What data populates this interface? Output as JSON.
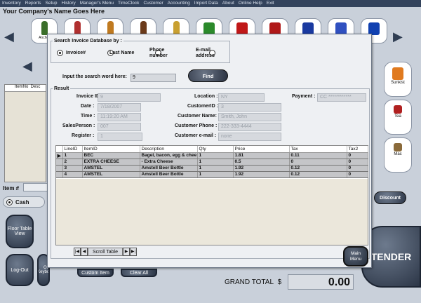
{
  "menubar": [
    "Inventory",
    "Reports",
    "Setup",
    "History",
    "Manager's Menu",
    "TimeClock",
    "Customer",
    "Accounting",
    "Import Data",
    "About",
    "Online Help",
    "Exit"
  ],
  "company_title": "Your Company's Name Goes Here",
  "top_products": [
    "Anchor",
    "",
    "",
    "",
    "",
    "",
    "",
    "",
    "",
    "",
    ""
  ],
  "right_products": [
    {
      "label": "Sunkist",
      "color": "#e07a1f"
    },
    {
      "label": "Tea",
      "color": "#b02020"
    },
    {
      "label": "Mac",
      "color": "#8a6a3a"
    }
  ],
  "background": {
    "item_label": "Item #",
    "cash_label": "Cash",
    "discount_label": "Discount",
    "floor_table_view": "Floor Table View",
    "log_out": "Log-Out",
    "on_keyboard": "On Keyboard",
    "custom_item": "Custom Item",
    "clear_all": "Clear All",
    "tender": "TENDER",
    "grand_total_label": "GRAND TOTAL",
    "currency": "$",
    "grand_total_value": "0.00"
  },
  "dialog": {
    "search_group": "Search Invoice Database by :",
    "radios": [
      {
        "label": "Invoice#",
        "selected": true
      },
      {
        "label": "Last Name",
        "selected": false
      },
      {
        "label": "Phone number",
        "selected": false
      },
      {
        "label": "E-mail address",
        "selected": false
      }
    ],
    "search_prompt": "Input the search word here:",
    "search_value": "9",
    "find_label": "Find",
    "result_group": "Result",
    "fields": {
      "invoice_id": {
        "label": "Invoice ID:",
        "value": "9"
      },
      "date": {
        "label": "Date :",
        "value": "7/18/2007"
      },
      "time": {
        "label": "Time :",
        "value": "11:19:20 AM"
      },
      "salesperson": {
        "label": "SalesPerson :",
        "value": "007"
      },
      "register": {
        "label": "Register :",
        "value": "1"
      },
      "location": {
        "label": "Location :",
        "value": "NY"
      },
      "customer_id": {
        "label": "CustomerID :",
        "value": "3"
      },
      "customer_name": {
        "label": "Customer Name:",
        "value": "Smith, John"
      },
      "customer_phone": {
        "label": "Customer Phone :",
        "value": "222-333-4444"
      },
      "customer_email": {
        "label": "Customer e-mail :",
        "value": "none"
      },
      "payment": {
        "label": "Payment :",
        "value": "CC ************"
      }
    },
    "table": {
      "columns": [
        "LineID",
        "ItemID",
        "Description",
        "Qty",
        "Price",
        "Tax",
        "Tax2"
      ],
      "rows": [
        [
          "1",
          "BEC",
          "Bagel, bacon, egg & chee",
          "1",
          "1.81",
          "0.11",
          "0"
        ],
        [
          "2",
          "EXTRA CHEESE",
          "- Extra Cheese",
          "1",
          "0.5",
          "0",
          "0"
        ],
        [
          "3",
          "AMSTEL",
          "Amstell Beer Bottle",
          "1",
          "1.92",
          "0.12",
          "0"
        ],
        [
          "4",
          "AMSTEL",
          "Amstell Beer Bottle",
          "1",
          "1.92",
          "0.12",
          "0"
        ]
      ]
    },
    "scroll_label": "Scroll Table",
    "main_menu_label": "Main Menu"
  }
}
